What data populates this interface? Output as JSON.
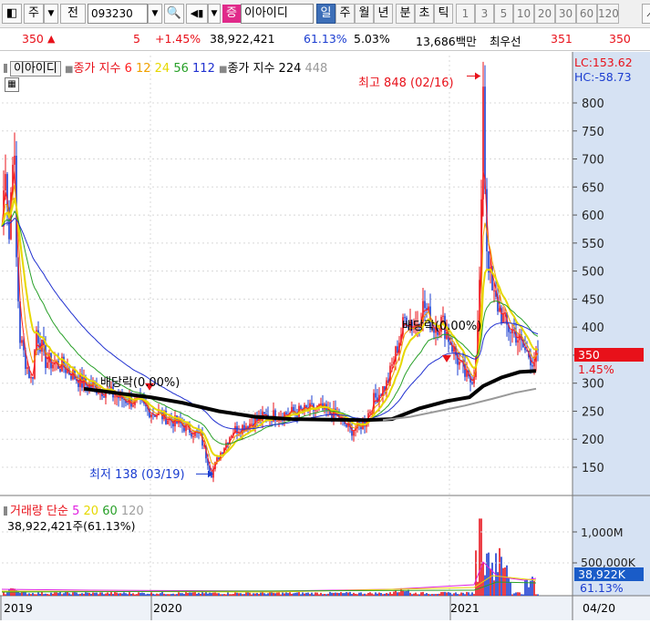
{
  "toolbar": {
    "market_label": "주",
    "prev_label": "전",
    "code_value": "093230",
    "type_badge": "증",
    "stock_name": "이아이디",
    "periods": [
      "일",
      "주",
      "월",
      "년",
      "분",
      "초",
      "틱"
    ],
    "active_period": "일",
    "intervals": [
      "1",
      "3",
      "5",
      "10",
      "20",
      "30",
      "60",
      "120"
    ]
  },
  "quote": {
    "price": "350",
    "change_arrow": "▲",
    "change": "5",
    "change_pct": "+1.45%",
    "volume": "38,922,421",
    "turnover_ratio": "61.13%",
    "rate": "5.03%",
    "amount": "13,686백만",
    "bid_label": "최우선",
    "bid": "351",
    "ask": "350"
  },
  "legend": {
    "name": "이아이디",
    "ma_label": "종가 지수",
    "ma_periods": [
      "6",
      "12",
      "24",
      "56",
      "112"
    ],
    "ma_colors": [
      "#ff2020",
      "#f0a000",
      "#e6d800",
      "#28a028",
      "#2030d0"
    ],
    "ma2_label": "종가 지수 224",
    "ma2_extra": "448",
    "lc": "LC:153.62",
    "hc": "HC:-58.73"
  },
  "annotations": {
    "high": "최고 848 (02/16)",
    "low": "최저 138 (03/19)",
    "div1": "배당락(0.00%)",
    "div2": "배당락(0.00%)"
  },
  "price_axis": {
    "ticks": [
      "800",
      "750",
      "700",
      "650",
      "600",
      "550",
      "500",
      "450",
      "400",
      "350",
      "300",
      "250",
      "200",
      "150"
    ],
    "current_price": "350",
    "current_pct": "1.45%"
  },
  "volume_panel": {
    "title": "거래량",
    "mode": "단순",
    "ma_periods": [
      "5",
      "20",
      "60",
      "120"
    ],
    "ma_colors": [
      "#e020e0",
      "#e6d800",
      "#28a028",
      "#a0a0a0"
    ],
    "summary": "38,922,421주(61.13%)",
    "ticks": [
      "1,000M",
      "500,000K"
    ],
    "current": "38,922K",
    "current_pct": "61.13%"
  },
  "x_axis": {
    "labels": [
      "2019",
      "2020",
      "2021"
    ],
    "right_label": "04/20"
  },
  "chart_data": {
    "type": "line",
    "title": "",
    "xlabel": "",
    "ylabel": "",
    "ylim": [
      100,
      870
    ],
    "x": [
      "2019-01",
      "2019-04",
      "2019-07",
      "2019-10",
      "2020-01",
      "2020-03",
      "2020-05",
      "2020-08",
      "2020-11",
      "2021-01",
      "2021-02",
      "2021-03",
      "2021-04"
    ],
    "series": [
      {
        "name": "종가",
        "values": [
          700,
          340,
          300,
          275,
          245,
          138,
          215,
          240,
          215,
          420,
          848,
          400,
          350
        ]
      },
      {
        "name": "224",
        "values": [
          320,
          330,
          300,
          285,
          270,
          255,
          240,
          232,
          230,
          245,
          290,
          305,
          322
        ]
      }
    ],
    "annotations": [
      {
        "label": "최고 848 (02/16)",
        "x": "2021-02-16",
        "y": 848
      },
      {
        "label": "최저 138 (03/19)",
        "x": "2020-03-19",
        "y": 138
      }
    ],
    "grid": true
  }
}
